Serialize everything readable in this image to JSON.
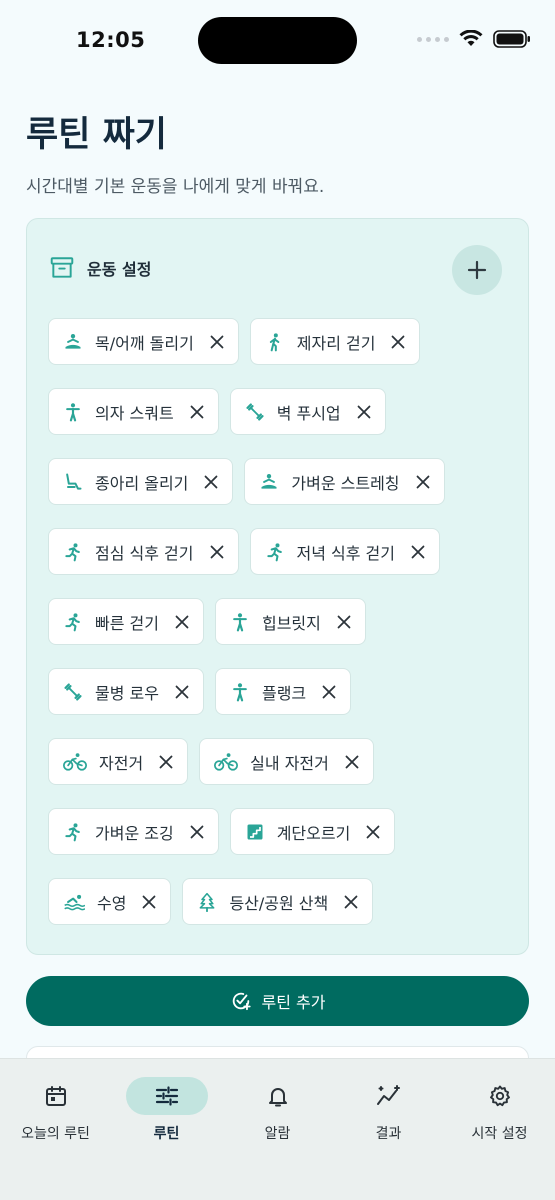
{
  "status_bar": {
    "time": "12:05"
  },
  "header": {
    "title": "루틴 짜기",
    "subtitle": "시간대별 기본 운동을 나에게 맞게 바꿔요."
  },
  "exercise_card": {
    "title": "운동 설정",
    "chips": [
      {
        "label": "목/어깨 돌리기",
        "icon": "meditation-icon"
      },
      {
        "label": "제자리 걷기",
        "icon": "walk-icon"
      },
      {
        "label": "의자 스쿼트",
        "icon": "person-standing-icon"
      },
      {
        "label": "벽 푸시업",
        "icon": "dumbbell-icon"
      },
      {
        "label": "종아리 올리기",
        "icon": "seat-icon"
      },
      {
        "label": "가벼운 스트레칭",
        "icon": "meditation-icon"
      },
      {
        "label": "점심 식후 걷기",
        "icon": "run-icon"
      },
      {
        "label": "저녁 식후 걷기",
        "icon": "run-icon"
      },
      {
        "label": "빠른 걷기",
        "icon": "run-icon"
      },
      {
        "label": "힙브릿지",
        "icon": "person-standing-icon"
      },
      {
        "label": "물병 로우",
        "icon": "dumbbell-icon"
      },
      {
        "label": "플랭크",
        "icon": "person-standing-icon"
      },
      {
        "label": "자전거",
        "icon": "bike-icon"
      },
      {
        "label": "실내 자전거",
        "icon": "bike-icon"
      },
      {
        "label": "가벼운 조깅",
        "icon": "run-icon"
      },
      {
        "label": "계단오르기",
        "icon": "stairs-icon"
      },
      {
        "label": "수영",
        "icon": "swim-icon"
      },
      {
        "label": "등산/공원 산책",
        "icon": "tree-icon"
      }
    ]
  },
  "actions": {
    "add_routine": "루틴 추가"
  },
  "bottom_nav": {
    "items": [
      {
        "label": "오늘의 루틴",
        "icon": "calendar-icon",
        "active": false
      },
      {
        "label": "루틴",
        "icon": "sliders-icon",
        "active": true
      },
      {
        "label": "알람",
        "icon": "bell-icon",
        "active": false
      },
      {
        "label": "결과",
        "icon": "chart-sparkle-icon",
        "active": false
      },
      {
        "label": "시작 설정",
        "icon": "gear-icon",
        "active": false
      }
    ]
  },
  "colors": {
    "accent": "#006b60",
    "chip_icon": "#2aa597",
    "card_bg": "#e2f5f3",
    "title": "#142a3d"
  }
}
